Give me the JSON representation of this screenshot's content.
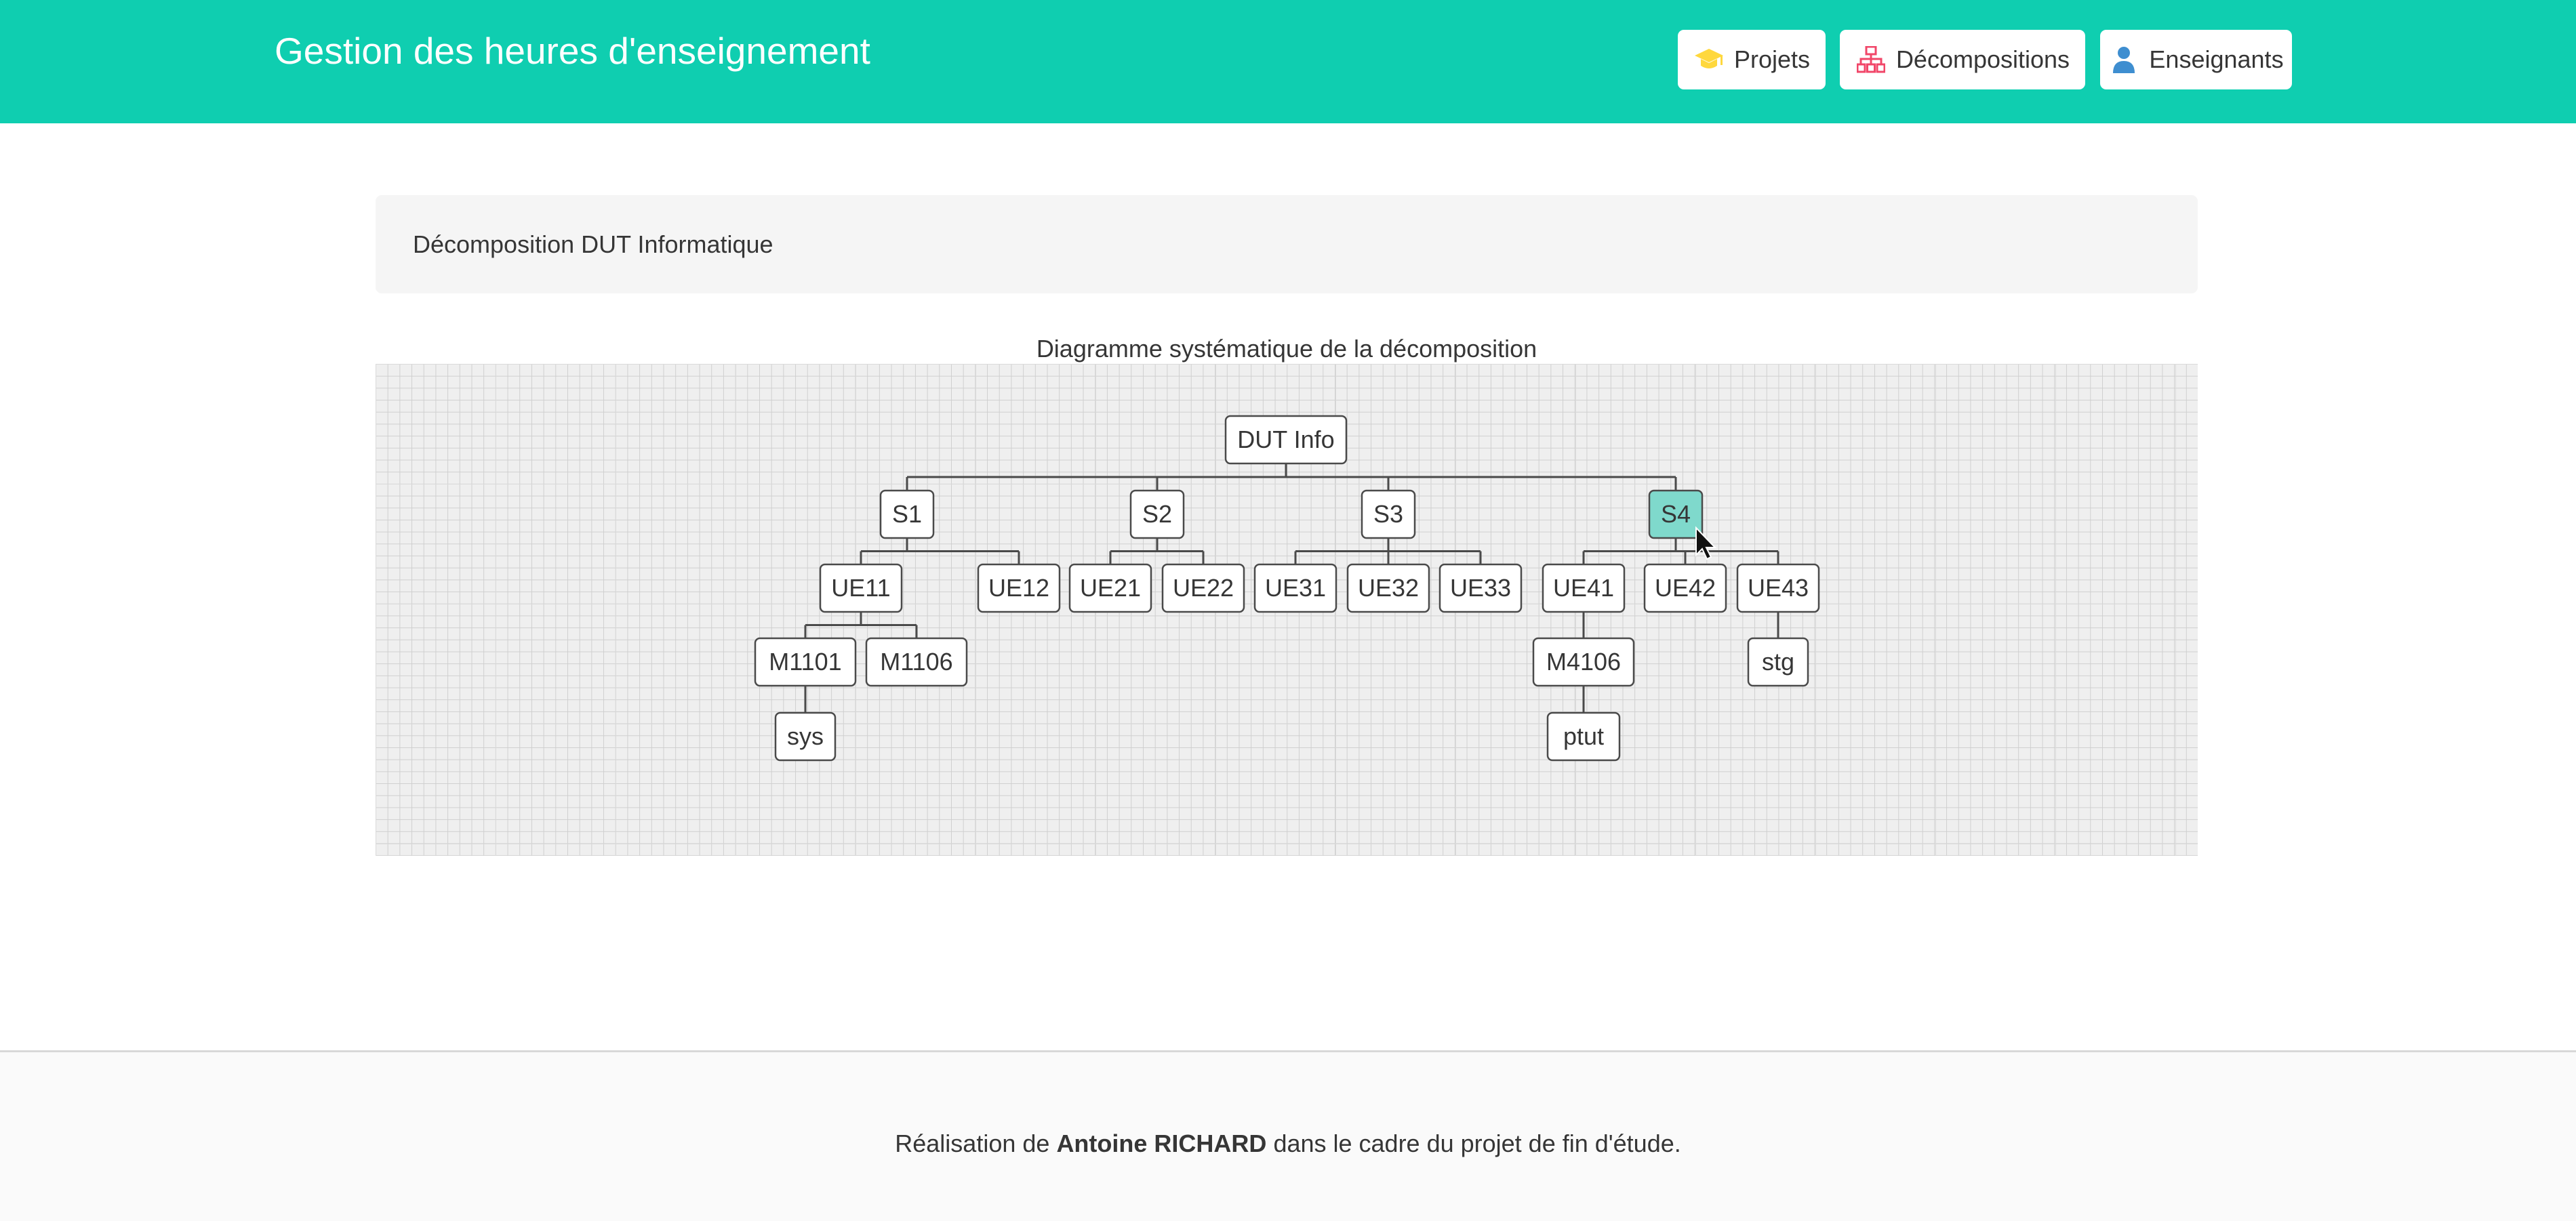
{
  "header": {
    "title": "Gestion des heures d'enseignement",
    "nav": [
      {
        "label": "Projets",
        "icon": "graduation-cap-icon",
        "icon_color": "#ffd83d"
      },
      {
        "label": "Décompositions",
        "icon": "sitemap-icon",
        "icon_color": "#f14668"
      },
      {
        "label": "Enseignants",
        "icon": "user-icon",
        "icon_color": "#3e8ed0"
      }
    ]
  },
  "panel": {
    "title": "Décomposition DUT Informatique"
  },
  "diagram": {
    "title": "Diagramme systématique de la décomposition",
    "selected": "S4",
    "selected_color": "#7fd9cc",
    "nodes": {
      "root": "DUT Info",
      "s1": "S1",
      "s2": "S2",
      "s3": "S3",
      "s4": "S4",
      "ue11": "UE11",
      "ue12": "UE12",
      "ue21": "UE21",
      "ue22": "UE22",
      "ue31": "UE31",
      "ue32": "UE32",
      "ue33": "UE33",
      "ue41": "UE41",
      "ue42": "UE42",
      "ue43": "UE43",
      "m1101": "M1101",
      "m1106": "M1106",
      "m4106": "M4106",
      "stg": "stg",
      "sys": "sys",
      "ptut": "ptut"
    }
  },
  "footer": {
    "prefix": "Réalisation de",
    "author": "Antoine RICHARD",
    "suffix": "dans le cadre du projet de fin d'étude."
  }
}
